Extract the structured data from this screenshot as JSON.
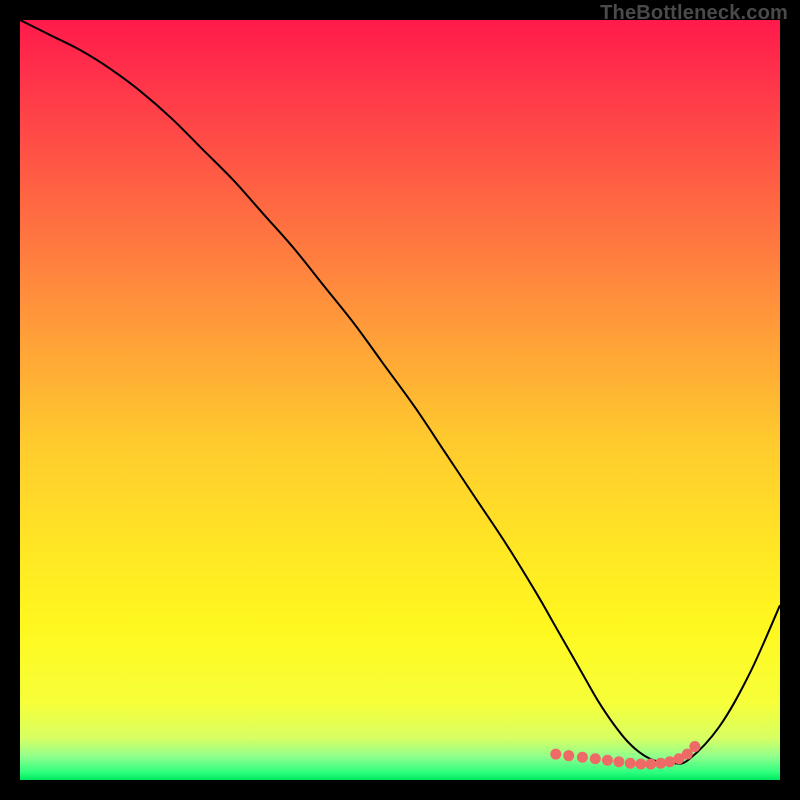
{
  "watermark": "TheBottleneck.com",
  "chart_data": {
    "type": "line",
    "title": "",
    "xlabel": "",
    "ylabel": "",
    "xlim": [
      0,
      100
    ],
    "ylim": [
      0,
      100
    ],
    "gradient_stops": [
      {
        "offset": 0.0,
        "color": "#ff1a4b"
      },
      {
        "offset": 0.1,
        "color": "#ff3a49"
      },
      {
        "offset": 0.25,
        "color": "#ff6a42"
      },
      {
        "offset": 0.4,
        "color": "#ff9a3a"
      },
      {
        "offset": 0.55,
        "color": "#ffc92e"
      },
      {
        "offset": 0.7,
        "color": "#ffe724"
      },
      {
        "offset": 0.8,
        "color": "#fff81f"
      },
      {
        "offset": 0.9,
        "color": "#f6ff3a"
      },
      {
        "offset": 0.945,
        "color": "#d8ff63"
      },
      {
        "offset": 0.97,
        "color": "#8dff8d"
      },
      {
        "offset": 0.99,
        "color": "#2dff7e"
      },
      {
        "offset": 1.0,
        "color": "#00e85e"
      }
    ],
    "series": [
      {
        "name": "bottleneck-curve",
        "color": "#000000",
        "stroke_width": 2,
        "x": [
          0,
          4,
          8,
          12,
          16,
          20,
          24,
          28,
          32,
          36,
          40,
          44,
          48,
          52,
          56,
          60,
          64,
          68,
          70,
          72,
          74,
          76,
          78,
          80,
          82,
          84,
          86,
          88,
          92,
          96,
          100
        ],
        "y": [
          100,
          98,
          96,
          93.5,
          90.5,
          87,
          83,
          79,
          74.5,
          70,
          65,
          60,
          54.5,
          49,
          43,
          37,
          31,
          24.5,
          21,
          17.5,
          14,
          10.5,
          7.5,
          5,
          3.3,
          2.4,
          2.2,
          2.7,
          7,
          14,
          23
        ]
      },
      {
        "name": "optimal-zone-markers",
        "color": "#ee6a66",
        "marker_radius": 5.5,
        "x": [
          70.5,
          72.2,
          74.0,
          75.7,
          77.3,
          78.8,
          80.3,
          81.7,
          83.0,
          84.3,
          85.5,
          86.7,
          87.8,
          88.8
        ],
        "y": [
          3.4,
          3.2,
          3.0,
          2.8,
          2.6,
          2.4,
          2.2,
          2.1,
          2.1,
          2.2,
          2.4,
          2.8,
          3.4,
          4.4
        ]
      }
    ]
  }
}
